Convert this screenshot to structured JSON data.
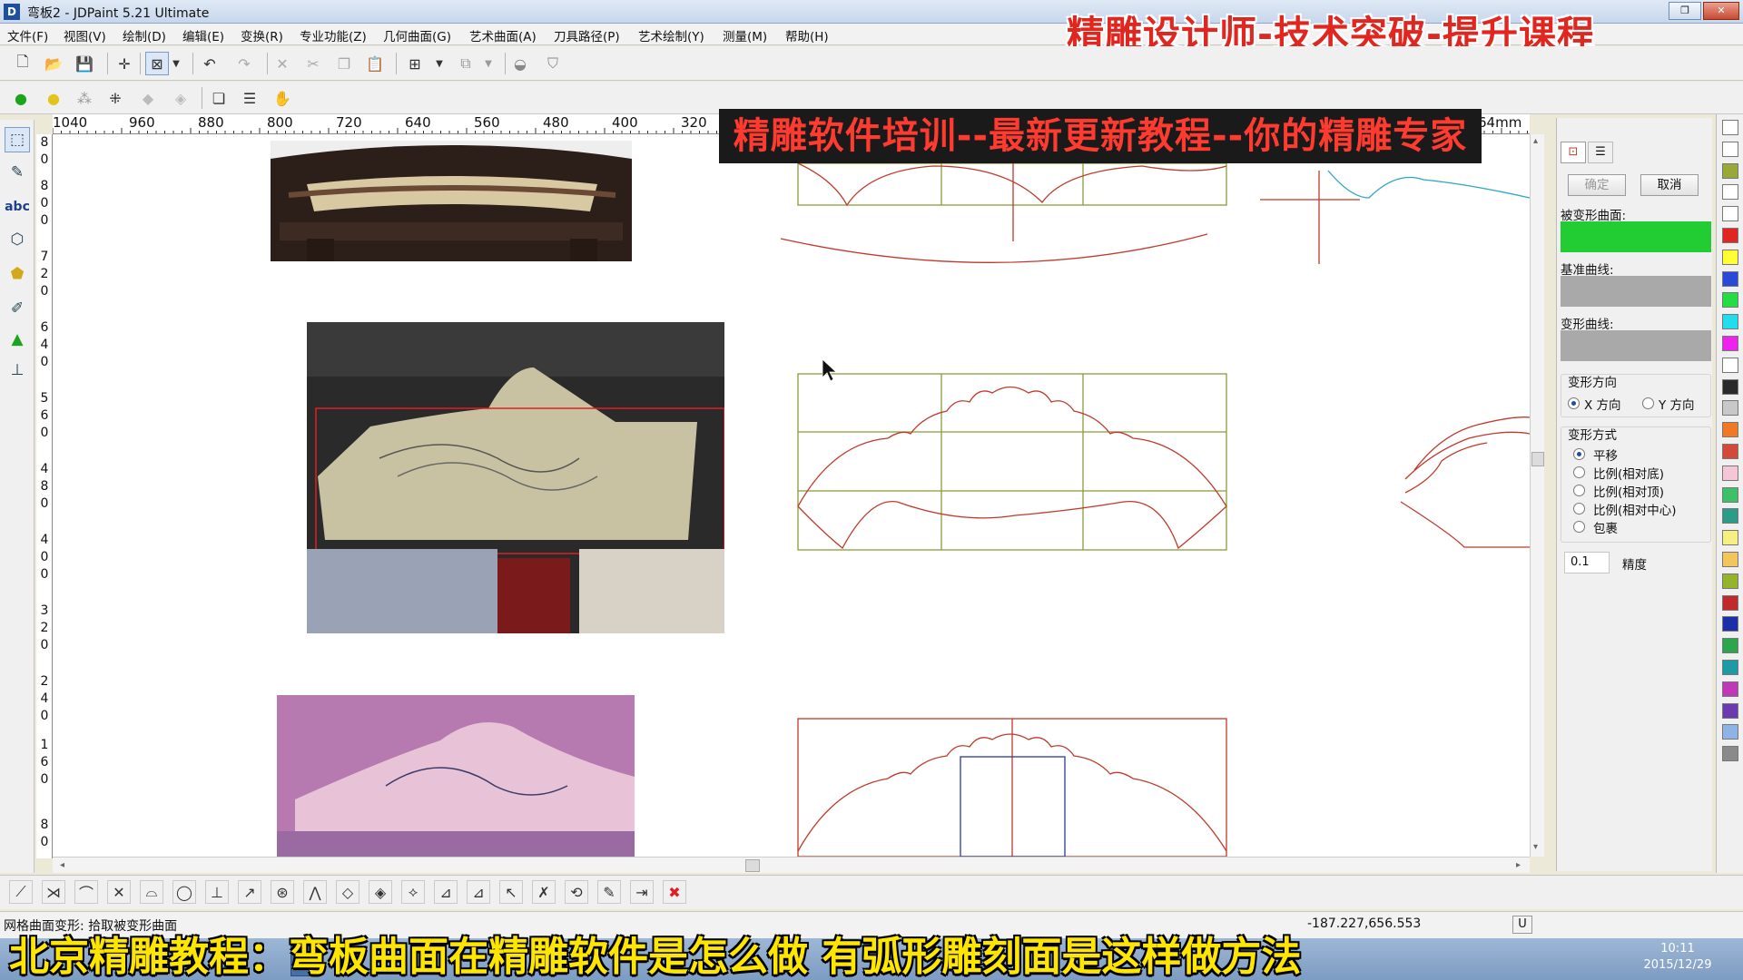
{
  "window": {
    "title": "弯板2 - JDPaint 5.21 Ultimate",
    "app_icon": "D",
    "controls": {
      "restore": "❐",
      "close": "✕"
    }
  },
  "menu": [
    "文件(F)",
    "视图(V)",
    "绘制(D)",
    "编辑(E)",
    "变换(R)",
    "专业功能(Z)",
    "几何曲面(G)",
    "艺术曲面(A)",
    "刀具路径(P)",
    "艺术绘制(Y)",
    "测量(M)",
    "帮助(H)"
  ],
  "overlay": {
    "top_banner": "精雕设计师-技术突破-提升课程",
    "mid_banner": "精雕软件培训--最新更新教程--你的精雕专家",
    "bottom_subtitle": "北京精雕教程：弯板曲面在精雕软件是怎么做 有弧形雕刻面是这样做方法"
  },
  "toolbar_icons": {
    "row1": [
      "new-file-icon",
      "open-folder-icon",
      "save-icon",
      "crosshair-icon",
      "select-window-icon",
      "dropdown-icon",
      "undo-icon",
      "redo-icon",
      "delete-icon",
      "cut-icon",
      "copy-icon",
      "paste-icon",
      "grid-snap-icon",
      "dropdown-icon",
      "view-3d-icon",
      "dropdown-icon",
      "shade-icon",
      "shield-icon"
    ],
    "row2": [
      "light-on-icon",
      "light-bulb-icon",
      "node-icon",
      "nodes-icon",
      "arrow-back-icon",
      "arrow-forward-icon",
      "layers-icon",
      "list-icon",
      "hand-icon"
    ]
  },
  "ruler": {
    "unit": "64mm",
    "h_ticks": [
      "1040",
      "960",
      "880",
      "800",
      "720",
      "640",
      "560",
      "480",
      "400",
      "320"
    ],
    "v_labels": [
      [
        "8",
        "0"
      ],
      [
        "8",
        "0",
        "0"
      ],
      [
        "7",
        "2",
        "0"
      ],
      [
        "6",
        "4",
        "0"
      ],
      [
        "5",
        "6",
        "0"
      ],
      [
        "4",
        "8",
        "0"
      ],
      [
        "4",
        "0",
        "0"
      ],
      [
        "3",
        "2",
        "0"
      ],
      [
        "2",
        "4",
        "0"
      ],
      [
        "1",
        "6",
        "0"
      ],
      [
        "8",
        "0"
      ]
    ]
  },
  "left_tools": [
    "select-tool-icon",
    "bezier-pen-icon",
    "text-tool-icon",
    "cube-icon",
    "polygon-tool-icon",
    "knife-icon",
    "bell-icon",
    "measure-icon"
  ],
  "right_panel": {
    "tab_icons": [
      "grid-deform-icon",
      "document-icon"
    ],
    "ok_button": "确定",
    "cancel_button": "取消",
    "surface_label": "被变形曲面:",
    "surface_color": "#22cc33",
    "base_curve_label": "基准曲线:",
    "deform_curve_label": "变形曲线:",
    "direction_title": "变形方向",
    "direction_options": [
      "X 方向",
      "Y 方向"
    ],
    "direction_selected": 0,
    "mode_title": "变形方式",
    "mode_options": [
      "平移",
      "比例(相对底)",
      "比例(相对顶)",
      "比例(相对中心)",
      "包裹"
    ],
    "mode_selected": 0,
    "precision_value": "0.1",
    "precision_label": "精度"
  },
  "palette": [
    "#ffffff",
    "#ffffff",
    "#9aa83a",
    "#ffffff",
    "#ffffff",
    "#e32521",
    "#ffff33",
    "#2a49d8",
    "#22dd44",
    "#22ddee",
    "#ee22ee",
    "#ffffff",
    "#2a2a2a",
    "#c8c8c8",
    "#f07a24",
    "#d34a3a",
    "#f5c6d6",
    "#3cc06a",
    "#2b9c8a",
    "#f6f083",
    "#f2c65a",
    "#96b42b",
    "#c02a2a",
    "#1c2ea8",
    "#2ba64a",
    "#1c9aa6",
    "#c038b8",
    "#6c3ab0",
    "#8eb4e6",
    "#8a8a8a"
  ],
  "draw_tools": [
    "line-icon",
    "multi-line-icon",
    "arc-icon",
    "trim-icon",
    "fillet-icon",
    "circle-icon",
    "perpendicular-icon",
    "tangent-icon",
    "snap-node-icon",
    "angle-icon",
    "diamond-icon",
    "diamond-outline-icon",
    "diamond-x-icon",
    "extend-icon",
    "extend-multi-icon",
    "pick-icon",
    "pick-x-icon",
    "transform-icon",
    "edit-node-icon",
    "join-icon",
    "cancel-x-icon"
  ],
  "status": {
    "message": "网格曲面变形: 拾取被变形曲面",
    "coordinates": "-187.227,656.553",
    "indicator": "U"
  },
  "taskbar": {
    "time": "10:11",
    "date": "2015/12/29"
  }
}
